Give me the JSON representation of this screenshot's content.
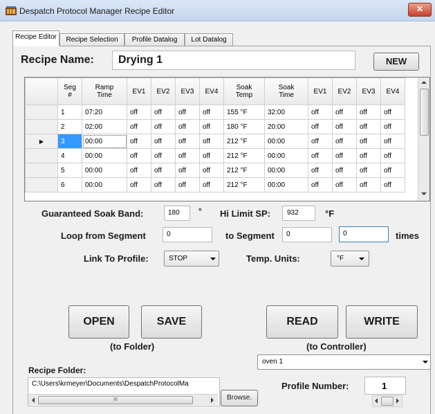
{
  "window": {
    "title": "Despatch Protocol Manager Recipe Editor",
    "close_glyph": "✕"
  },
  "tabs": [
    {
      "label": "Recipe Editor",
      "active": true
    },
    {
      "label": "Recipe Selection",
      "active": false
    },
    {
      "label": "Profile Datalog",
      "active": false
    },
    {
      "label": "Lot Datalog",
      "active": false
    }
  ],
  "recipe": {
    "name_label": "Recipe Name:",
    "name_value": "Drying 1",
    "new_button": "NEW"
  },
  "grid": {
    "columns": [
      {
        "line1": "Seg",
        "line2": "#"
      },
      {
        "line1": "Ramp",
        "line2": "Time"
      },
      {
        "line1": "EV1",
        "line2": ""
      },
      {
        "line1": "EV2",
        "line2": ""
      },
      {
        "line1": "EV3",
        "line2": ""
      },
      {
        "line1": "EV4",
        "line2": ""
      },
      {
        "line1": "Soak",
        "line2": "Temp"
      },
      {
        "line1": "Soak",
        "line2": "Time"
      },
      {
        "line1": "EV1",
        "line2": ""
      },
      {
        "line1": "EV2",
        "line2": ""
      },
      {
        "line1": "EV3",
        "line2": ""
      },
      {
        "line1": "EV4",
        "line2": ""
      }
    ],
    "current_row_marker": "▶",
    "rows": [
      [
        "1",
        "07:20",
        "off",
        "off",
        "off",
        "off",
        "155 °F",
        "32:00",
        "off",
        "off",
        "off",
        "off"
      ],
      [
        "2",
        "02:00",
        "off",
        "off",
        "off",
        "off",
        "180 °F",
        "20:00",
        "off",
        "off",
        "off",
        "off"
      ],
      [
        "3",
        "00:00",
        "off",
        "off",
        "off",
        "off",
        "212 °F",
        "00:00",
        "off",
        "off",
        "off",
        "off"
      ],
      [
        "4",
        "00:00",
        "off",
        "off",
        "off",
        "off",
        "212 °F",
        "00:00",
        "off",
        "off",
        "off",
        "off"
      ],
      [
        "5",
        "00:00",
        "off",
        "off",
        "off",
        "off",
        "212 °F",
        "00:00",
        "off",
        "off",
        "off",
        "off"
      ],
      [
        "6",
        "00:00",
        "off",
        "off",
        "off",
        "off",
        "212 °F",
        "00:00",
        "off",
        "off",
        "off",
        "off"
      ]
    ]
  },
  "soak": {
    "label": "Guaranteed Soak Band:",
    "value": "180",
    "unit": "°",
    "hilimit_label": "Hi Limit SP:",
    "hilimit_value": "932",
    "hilimit_unit": "°F"
  },
  "loop": {
    "from_label": "Loop from Segment",
    "from_value": "0",
    "to_label": "to Segment",
    "to_value": "0",
    "times_value": "0",
    "times_label": "times"
  },
  "link": {
    "label": "Link To Profile:",
    "value": "STOP",
    "units_label": "Temp. Units:",
    "units_value": "°F"
  },
  "folder_buttons": {
    "open": "OPEN",
    "save": "SAVE",
    "caption": "(to Folder)"
  },
  "controller_buttons": {
    "read": "READ",
    "write": "WRITE",
    "caption": "(to Controller)"
  },
  "controller": {
    "value": "oven 1"
  },
  "recipe_folder": {
    "label": "Recipe Folder:",
    "path": "C:\\Users\\krmeyer\\Documents\\DespatchProtocolMa",
    "browse": "Browse.",
    "scroll_thumb": "III"
  },
  "profile": {
    "label": "Profile Number:",
    "value": "1"
  }
}
